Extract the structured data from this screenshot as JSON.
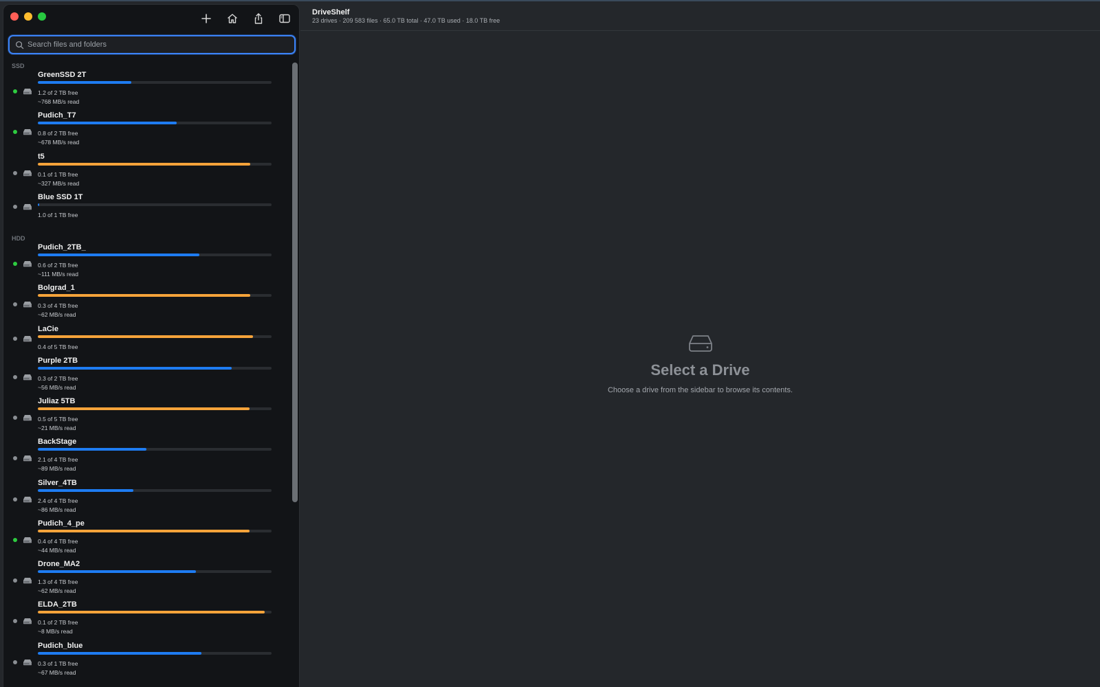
{
  "app": {
    "title": "DriveShelf",
    "subtitle": "23 drives · 209 583 files · 65.0 TB total · 47.0 TB used · 18.0 TB free"
  },
  "search": {
    "placeholder": "Search files and folders",
    "value": ""
  },
  "toolbar": {
    "icons": [
      "plus-icon",
      "home-icon",
      "share-icon",
      "sidebar-toggle-icon"
    ]
  },
  "colors": {
    "online": "#2ecc40",
    "offline": "#8a8e93",
    "bar_blue": "#1e7cf2",
    "bar_orange": "#f5a33a",
    "red": "#ff5f57",
    "yellow": "#febc2e",
    "green": "#28c840"
  },
  "sections": [
    {
      "label": "SSD",
      "drives": [
        {
          "name": "GreenSSD 2T",
          "free": "1.2 of 2 TB free",
          "speed": "~768 MB/s read",
          "used": 0.4,
          "bar": "blue",
          "online": true
        },
        {
          "name": "Pudich_T7",
          "free": "0.8 of 2 TB free",
          "speed": "~678 MB/s read",
          "used": 0.595,
          "bar": "blue",
          "online": true
        },
        {
          "name": "t5",
          "free": "0.1 of 1 TB free",
          "speed": "~327 MB/s read",
          "used": 0.91,
          "bar": "orange",
          "online": false
        },
        {
          "name": "Blue SSD 1T",
          "free": "1.0 of 1 TB free",
          "speed": "",
          "used": 0.005,
          "bar": "blue",
          "online": false
        }
      ]
    },
    {
      "label": "HDD",
      "drives": [
        {
          "name": "Pudich_2TB_",
          "free": "0.6 of 2 TB free",
          "speed": "~111 MB/s read",
          "used": 0.69,
          "bar": "blue",
          "online": true
        },
        {
          "name": "Bolgrad_1",
          "free": "0.3 of 4 TB free",
          "speed": "~62 MB/s read",
          "used": 0.91,
          "bar": "orange",
          "online": false
        },
        {
          "name": "LaCie",
          "free": "0.4 of 5 TB free",
          "speed": "",
          "used": 0.92,
          "bar": "orange",
          "online": false
        },
        {
          "name": "Purple 2TB",
          "free": "0.3 of 2 TB free",
          "speed": "~56 MB/s read",
          "used": 0.83,
          "bar": "blue",
          "online": false
        },
        {
          "name": "Juliaz 5TB",
          "free": "0.5 of 5 TB free",
          "speed": "~21 MB/s read",
          "used": 0.905,
          "bar": "orange",
          "online": false
        },
        {
          "name": "BackStage",
          "free": "2.1 of 4 TB free",
          "speed": "~89 MB/s read",
          "used": 0.465,
          "bar": "blue",
          "online": false
        },
        {
          "name": "Silver_4TB",
          "free": "2.4 of 4 TB free",
          "speed": "~86 MB/s read",
          "used": 0.41,
          "bar": "blue",
          "online": false
        },
        {
          "name": "Pudich_4_pe",
          "free": "0.4 of 4 TB free",
          "speed": "~44 MB/s read",
          "used": 0.905,
          "bar": "orange",
          "online": true
        },
        {
          "name": "Drone_MA2",
          "free": "1.3 of 4 TB free",
          "speed": "~62 MB/s read",
          "used": 0.675,
          "bar": "blue",
          "online": false
        },
        {
          "name": "ELDA_2TB",
          "free": "0.1 of 2 TB free",
          "speed": "~8 MB/s read",
          "used": 0.97,
          "bar": "orange",
          "online": false
        },
        {
          "name": "Pudich_blue",
          "free": "0.3 of 1 TB free",
          "speed": "~67 MB/s read",
          "used": 0.7,
          "bar": "blue",
          "online": false
        }
      ]
    }
  ],
  "empty_state": {
    "icon": "drive-icon",
    "title": "Select a Drive",
    "subtitle": "Choose a drive from the sidebar to browse its contents."
  }
}
